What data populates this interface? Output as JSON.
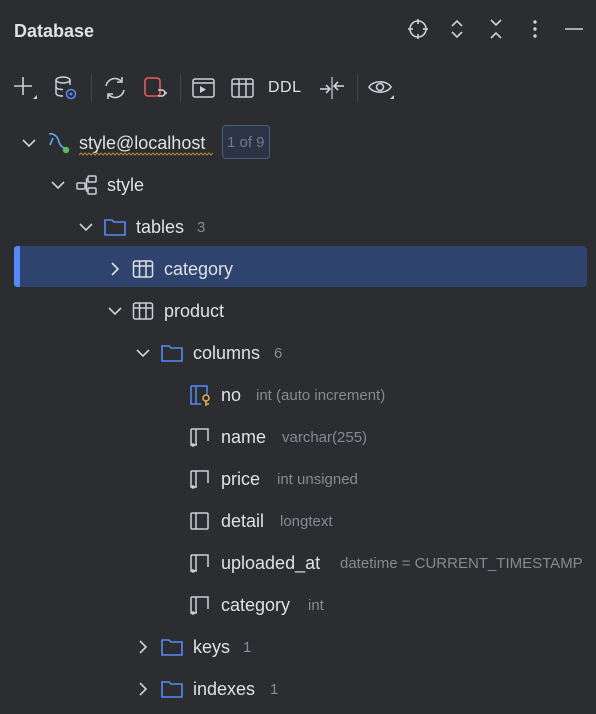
{
  "header": {
    "title": "Database",
    "buttons": [
      "locate-icon",
      "expand-all-icon",
      "collapse-all-icon",
      "more-icon",
      "minimize-icon"
    ]
  },
  "toolbar": {
    "ddl_label": "DDL",
    "buttons": [
      "add-icon",
      "data-source-properties-icon",
      "refresh-icon",
      "disconnect-icon",
      "query-console-icon",
      "table-view-icon",
      "ddl-button",
      "compare-icon",
      "view-options-icon"
    ]
  },
  "tree": {
    "connection": {
      "label": "style@localhost",
      "badge": "1 of 9"
    },
    "schema": {
      "label": "style"
    },
    "tables": {
      "label": "tables",
      "count": "3"
    },
    "category_table": {
      "label": "category"
    },
    "product_table": {
      "label": "product"
    },
    "columns": {
      "label": "columns",
      "count": "6"
    },
    "column_list": [
      {
        "name": "no",
        "type": "int (auto increment)"
      },
      {
        "name": "name",
        "type": "varchar(255)"
      },
      {
        "name": "price",
        "type": "int unsigned"
      },
      {
        "name": "detail",
        "type": "longtext"
      },
      {
        "name": "uploaded_at",
        "type": "datetime = CURRENT_TIMESTAMP"
      },
      {
        "name": "category",
        "type": "int"
      }
    ],
    "keys": {
      "label": "keys",
      "count": "1"
    },
    "indexes": {
      "label": "indexes",
      "count": "1"
    }
  },
  "colors": {
    "background": "#2b2d30",
    "selection": "#2e436e",
    "accent": "#548af7",
    "folder": "#548af7",
    "text": "#dfe1e5",
    "muted": "#868a91"
  }
}
